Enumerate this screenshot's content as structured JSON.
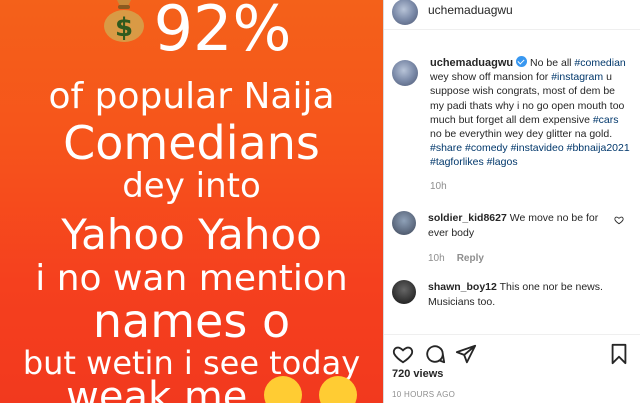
{
  "image_text": {
    "line1": "92%",
    "line2": "of popular Naija",
    "line3": "Comedians",
    "line4": "dey into",
    "line5": "Yahoo Yahoo",
    "line6": "i no wan mention",
    "line7": "names o",
    "line8": "but wetin i see today",
    "line9": "weak me",
    "bag_label": "$"
  },
  "header": {
    "username": "uchemaduagwu"
  },
  "caption": {
    "username": "uchemaduagwu",
    "text_1": " No be all ",
    "tag_comedian": "#comedian",
    "text_2": " wey show off mansion for ",
    "tag_instagram": "#instagram",
    "text_3": " u suppose wish congrats, most of dem be my padi thats why i no go open mouth too much but forget all dem expensive ",
    "tag_cars": "#cars",
    "text_4": " no be everythin wey dey glitter na gold.",
    "tags_line": [
      "#share",
      "#comedy",
      "#instavideo",
      "#bbnaija2021",
      "#tagforlikes",
      "#lagos"
    ],
    "time": "10h"
  },
  "comments": [
    {
      "username": "soldier_kid8627",
      "text": "We move no be for ever body",
      "time": "10h",
      "reply": "Reply"
    },
    {
      "username": "shawn_boy12",
      "text": "This one nor be news. Musicians too."
    }
  ],
  "stats": {
    "views": "720 views",
    "posted": "10 HOURS AGO"
  },
  "colors": {
    "bg_orange": "#f4611a",
    "hashtag": "#00376b",
    "verified": "#3897f0",
    "muted": "#8e8e8e"
  }
}
